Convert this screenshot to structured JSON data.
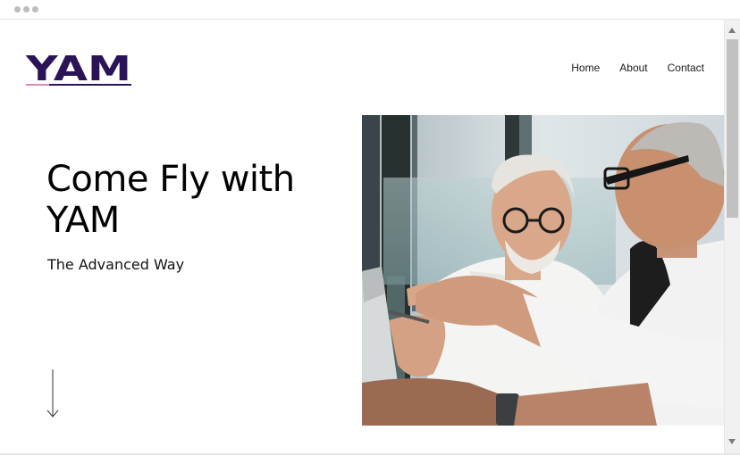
{
  "window": {
    "chrome_dots": 3
  },
  "header": {
    "logo_text": "YAM",
    "nav": [
      {
        "label": "Home"
      },
      {
        "label": "About"
      },
      {
        "label": "Contact"
      }
    ]
  },
  "hero": {
    "title": "Come Fly with YAM",
    "subtitle": "The Advanced Way"
  },
  "colors": {
    "logo_purple": "#2a1457",
    "logo_pink_underline": "#d98ab9",
    "text": "#000000"
  },
  "icons": {
    "scroll_down": "arrow-down-icon",
    "scroll_up": "scroll-up-arrow-icon",
    "scroll_down_button": "scroll-down-arrow-icon"
  }
}
